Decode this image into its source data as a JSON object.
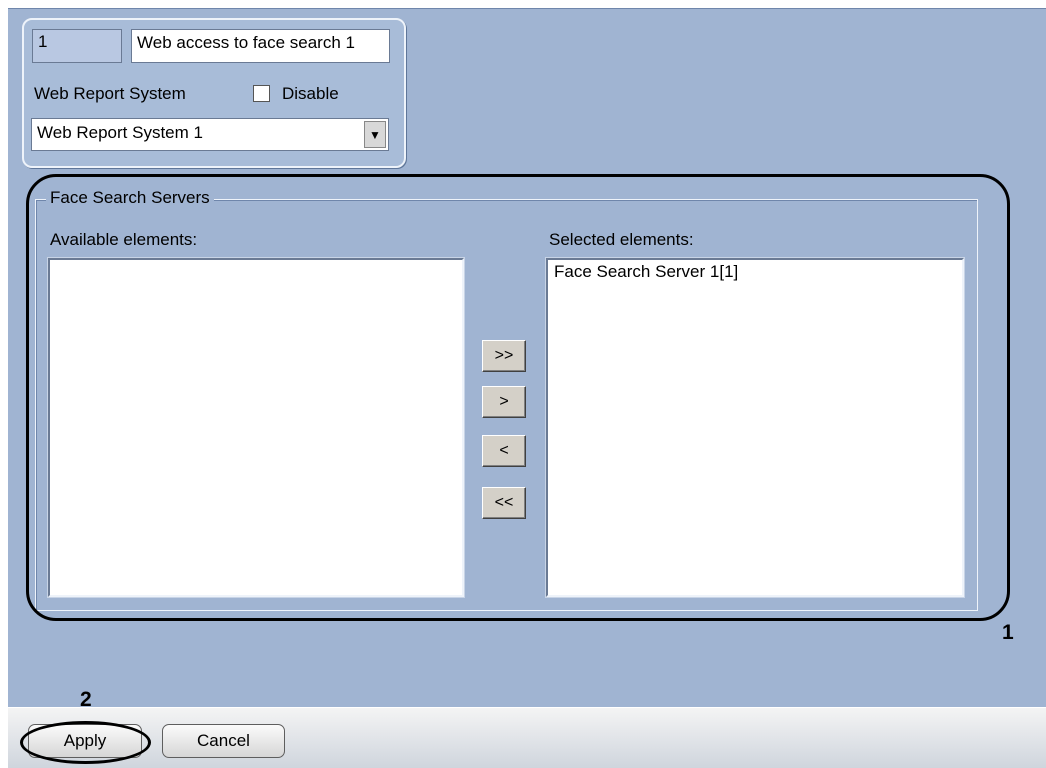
{
  "header": {
    "id_value": "1",
    "name_value": "Web access to face search 1",
    "web_report_label": "Web Report System",
    "disable_label": "Disable",
    "disable_checked": false,
    "system_selected": "Web Report System 1"
  },
  "group": {
    "title": "Face Search Servers",
    "available_label": "Available elements:",
    "selected_label": "Selected elements:",
    "available_items": [],
    "selected_items": [
      "Face Search Server 1[1]"
    ]
  },
  "move_buttons": {
    "add_all": ">>",
    "add_one": ">",
    "remove_one": "<",
    "remove_all": "<<"
  },
  "footer": {
    "apply_label": "Apply",
    "cancel_label": "Cancel"
  },
  "callouts": {
    "one": "1",
    "two": "2"
  }
}
